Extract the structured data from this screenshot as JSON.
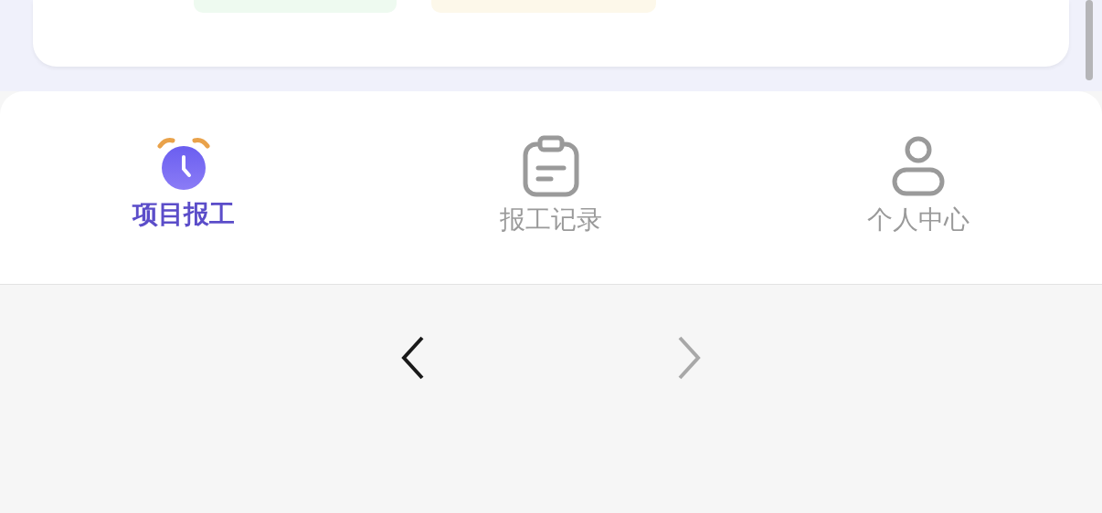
{
  "tabs": [
    {
      "label": "项目报工",
      "kind": "clock",
      "selected": true
    },
    {
      "label": "报工记录",
      "kind": "clipboard",
      "selected": false
    },
    {
      "label": "个人中心",
      "kind": "person",
      "selected": false
    }
  ],
  "browser_nav": {
    "back": {
      "disabled": false
    },
    "forward": {
      "disabled": true
    }
  }
}
